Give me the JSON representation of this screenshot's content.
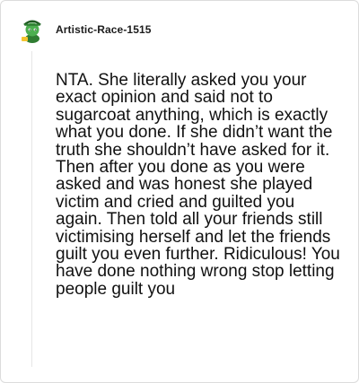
{
  "comment": {
    "author": "Artistic-Race-1515",
    "body": "NTA. She literally asked you your exact opinion and said not to sugarcoat anything, which is exactly what you done. If she didn’t want the truth she shouldn’t have asked for it. Then after you done as you were asked and was honest she played victim and cried and guilted you again. Then told all your friends still victimising herself and let the friends guilt you even further. Ridiculous! You have done nothing wrong stop letting people guilt you"
  },
  "avatar": {
    "icon": "snoo-avatar-icon",
    "colors": {
      "hat": "#2f7d32",
      "hat_shadow": "#1e5a22",
      "face": "#4caf50",
      "accent": "#f4c430"
    }
  }
}
